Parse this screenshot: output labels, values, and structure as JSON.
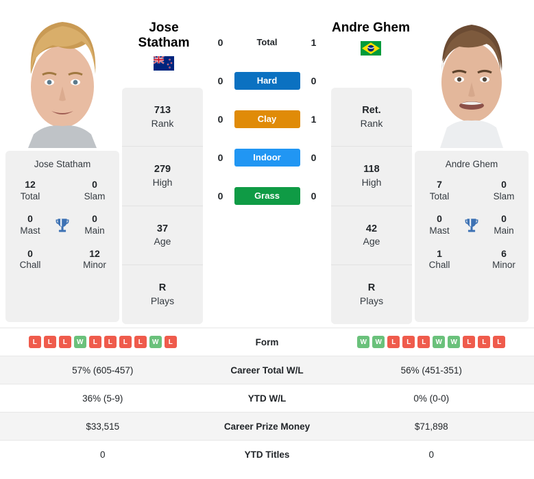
{
  "players": {
    "left": {
      "name": "Jose Statham",
      "name_line1": "Jose",
      "name_line2": "Statham",
      "country": "New Zealand",
      "flag": "nz-flag",
      "card_name": "Jose Statham",
      "titles": {
        "total": "12",
        "total_label": "Total",
        "slam": "0",
        "slam_label": "Slam",
        "mast": "0",
        "mast_label": "Mast",
        "main": "0",
        "main_label": "Main",
        "chall": "0",
        "chall_label": "Chall",
        "minor": "12",
        "minor_label": "Minor"
      },
      "stats": [
        {
          "value": "713",
          "label": "Rank"
        },
        {
          "value": "279",
          "label": "High"
        },
        {
          "value": "37",
          "label": "Age"
        },
        {
          "value": "R",
          "label": "Plays"
        }
      ],
      "form": [
        "L",
        "L",
        "L",
        "W",
        "L",
        "L",
        "L",
        "L",
        "W",
        "L"
      ],
      "career_total_wl": "57% (605-457)",
      "ytd_wl": "36% (5-9)",
      "career_prize_money": "$33,515",
      "ytd_titles": "0"
    },
    "right": {
      "name": "Andre Ghem",
      "name_line1": "Andre Ghem",
      "name_line2": "",
      "country": "Brazil",
      "flag": "br-flag",
      "card_name": "Andre Ghem",
      "titles": {
        "total": "7",
        "total_label": "Total",
        "slam": "0",
        "slam_label": "Slam",
        "mast": "0",
        "mast_label": "Mast",
        "main": "0",
        "main_label": "Main",
        "chall": "1",
        "chall_label": "Chall",
        "minor": "6",
        "minor_label": "Minor"
      },
      "stats": [
        {
          "value": "Ret.",
          "label": "Rank"
        },
        {
          "value": "118",
          "label": "High"
        },
        {
          "value": "42",
          "label": "Age"
        },
        {
          "value": "R",
          "label": "Plays"
        }
      ],
      "form": [
        "W",
        "W",
        "L",
        "L",
        "L",
        "W",
        "W",
        "L",
        "L",
        "L"
      ],
      "career_total_wl": "56% (451-351)",
      "ytd_wl": "0% (0-0)",
      "career_prize_money": "$71,898",
      "ytd_titles": "0"
    }
  },
  "h2h": {
    "total": {
      "label": "Total",
      "left": "0",
      "right": "1"
    },
    "surfaces": [
      {
        "label": "Hard",
        "left": "0",
        "right": "0",
        "color": "#0b71c1"
      },
      {
        "label": "Clay",
        "left": "0",
        "right": "1",
        "color": "#e08b08"
      },
      {
        "label": "Indoor",
        "left": "0",
        "right": "0",
        "color": "#2196f3"
      },
      {
        "label": "Grass",
        "left": "0",
        "right": "0",
        "color": "#0f9b45"
      }
    ]
  },
  "table": {
    "rows": [
      {
        "label": "Form",
        "type": "badges"
      },
      {
        "label": "Career Total W/L",
        "type": "text",
        "key": "career_total_wl"
      },
      {
        "label": "YTD W/L",
        "type": "text",
        "key": "ytd_wl"
      },
      {
        "label": "Career Prize Money",
        "type": "text",
        "key": "career_prize_money"
      },
      {
        "label": "YTD Titles",
        "type": "text",
        "key": "ytd_titles"
      }
    ]
  },
  "colors": {
    "win_badge": "#6ac17b",
    "loss_badge": "#ef5b4c",
    "card_bg": "#f0f0f0",
    "trophy": "#3d72b4"
  }
}
